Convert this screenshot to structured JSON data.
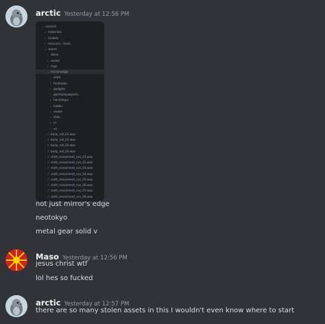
{
  "messages": [
    {
      "username": "arctic",
      "timestamp": "Yesterday at 12:56 PM",
      "attachment_tree": [
        {
          "label": "content",
          "depth": 0,
          "icon": "folder"
        },
        {
          "label": "materials",
          "depth": 1,
          "icon": "folder"
        },
        {
          "label": "models",
          "depth": 1,
          "icon": "folder"
        },
        {
          "label": "resource - fonts",
          "depth": 1,
          "icon": "folder"
        },
        {
          "label": "sound",
          "depth": 1,
          "icon": "folder"
        },
        {
          "label": "deise",
          "depth": 2,
          "icon": "folder"
        },
        {
          "label": "melee",
          "depth": 2,
          "icon": "folder"
        },
        {
          "label": "mgs",
          "depth": 2,
          "icon": "folder"
        },
        {
          "label": "mirrorsedge",
          "depth": 2,
          "icon": "folder",
          "selected": true
        },
        {
          "label": "cloth",
          "depth": 3,
          "icon": "folder"
        },
        {
          "label": "footsteps",
          "depth": 3,
          "icon": "folder"
        },
        {
          "label": "gadgets",
          "depth": 3,
          "icon": "folder"
        },
        {
          "label": "gameplayobjects",
          "depth": 3,
          "icon": "folder"
        },
        {
          "label": "handsteps",
          "depth": 3,
          "icon": "folder"
        },
        {
          "label": "ladder",
          "depth": 3,
          "icon": "folder"
        },
        {
          "label": "melee",
          "depth": 3,
          "icon": "folder"
        },
        {
          "label": "slide",
          "depth": 3,
          "icon": "folder"
        },
        {
          "label": "ui",
          "depth": 3,
          "icon": "folder"
        },
        {
          "label": "vo",
          "depth": 3,
          "icon": "folder"
        },
        {
          "label": "body_roll_01.wav",
          "depth": 2,
          "icon": "wav"
        },
        {
          "label": "body_roll_02.wav",
          "depth": 2,
          "icon": "wav"
        },
        {
          "label": "body_roll_03.wav",
          "depth": 2,
          "icon": "wav"
        },
        {
          "label": "body_roll_04.wav",
          "depth": 2,
          "icon": "wav"
        },
        {
          "label": "cloth_movement_run_01.wav",
          "depth": 2,
          "icon": "wav"
        },
        {
          "label": "cloth_movement_run_02.wav",
          "depth": 2,
          "icon": "wav"
        },
        {
          "label": "cloth_movement_run_03.wav",
          "depth": 2,
          "icon": "wav"
        },
        {
          "label": "cloth_movement_run_04.wav",
          "depth": 2,
          "icon": "wav"
        },
        {
          "label": "cloth_movement_run_05.wav",
          "depth": 2,
          "icon": "wav"
        },
        {
          "label": "cloth_movement_run_06.wav",
          "depth": 2,
          "icon": "wav"
        },
        {
          "label": "cloth_movement_run_07.wav",
          "depth": 2,
          "icon": "wav"
        },
        {
          "label": "cloth_movement_run_08.wav",
          "depth": 2,
          "icon": "wav"
        }
      ],
      "lines": [
        "not just mirror's edge",
        "neotokyo",
        "metal gear solid v"
      ]
    },
    {
      "username": "Maso",
      "timestamp": "Yesterday at 12:56 PM",
      "lines": [
        "jesus christ wtf",
        "lol hes so fucked"
      ]
    },
    {
      "username": "arctic",
      "timestamp": "Yesterday at 12:57 PM",
      "lines": [
        "there are so many stolen assets in this I wouldn't even know where to start"
      ]
    }
  ],
  "colors": {
    "background": "#313338",
    "username": "#f2f3f5",
    "timestamp": "#949ba4",
    "text": "#dbdee1",
    "attachment_bg": "#1e1f22"
  }
}
